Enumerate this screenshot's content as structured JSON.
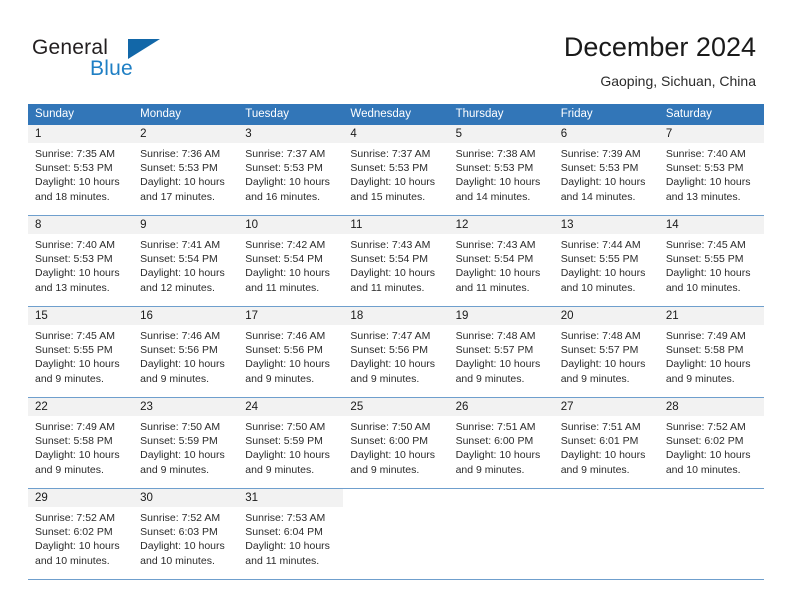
{
  "brand": {
    "word1": "General",
    "word2": "Blue",
    "triangle_color": "#1267a8",
    "blue_text_color": "#1f7fc4"
  },
  "header": {
    "title": "December 2024",
    "subtitle": "Gaoping, Sichuan, China"
  },
  "theme": {
    "header_blue": "#3276b8",
    "grid_line": "#6f9fcd",
    "daynum_band": "#f2f2f2"
  },
  "weekdays": [
    "Sunday",
    "Monday",
    "Tuesday",
    "Wednesday",
    "Thursday",
    "Friday",
    "Saturday"
  ],
  "weeks": [
    [
      {
        "day": "1",
        "sunrise": "Sunrise: 7:35 AM",
        "sunset": "Sunset: 5:53 PM",
        "daylight1": "Daylight: 10 hours",
        "daylight2": "and 18 minutes."
      },
      {
        "day": "2",
        "sunrise": "Sunrise: 7:36 AM",
        "sunset": "Sunset: 5:53 PM",
        "daylight1": "Daylight: 10 hours",
        "daylight2": "and 17 minutes."
      },
      {
        "day": "3",
        "sunrise": "Sunrise: 7:37 AM",
        "sunset": "Sunset: 5:53 PM",
        "daylight1": "Daylight: 10 hours",
        "daylight2": "and 16 minutes."
      },
      {
        "day": "4",
        "sunrise": "Sunrise: 7:37 AM",
        "sunset": "Sunset: 5:53 PM",
        "daylight1": "Daylight: 10 hours",
        "daylight2": "and 15 minutes."
      },
      {
        "day": "5",
        "sunrise": "Sunrise: 7:38 AM",
        "sunset": "Sunset: 5:53 PM",
        "daylight1": "Daylight: 10 hours",
        "daylight2": "and 14 minutes."
      },
      {
        "day": "6",
        "sunrise": "Sunrise: 7:39 AM",
        "sunset": "Sunset: 5:53 PM",
        "daylight1": "Daylight: 10 hours",
        "daylight2": "and 14 minutes."
      },
      {
        "day": "7",
        "sunrise": "Sunrise: 7:40 AM",
        "sunset": "Sunset: 5:53 PM",
        "daylight1": "Daylight: 10 hours",
        "daylight2": "and 13 minutes."
      }
    ],
    [
      {
        "day": "8",
        "sunrise": "Sunrise: 7:40 AM",
        "sunset": "Sunset: 5:53 PM",
        "daylight1": "Daylight: 10 hours",
        "daylight2": "and 13 minutes."
      },
      {
        "day": "9",
        "sunrise": "Sunrise: 7:41 AM",
        "sunset": "Sunset: 5:54 PM",
        "daylight1": "Daylight: 10 hours",
        "daylight2": "and 12 minutes."
      },
      {
        "day": "10",
        "sunrise": "Sunrise: 7:42 AM",
        "sunset": "Sunset: 5:54 PM",
        "daylight1": "Daylight: 10 hours",
        "daylight2": "and 11 minutes."
      },
      {
        "day": "11",
        "sunrise": "Sunrise: 7:43 AM",
        "sunset": "Sunset: 5:54 PM",
        "daylight1": "Daylight: 10 hours",
        "daylight2": "and 11 minutes."
      },
      {
        "day": "12",
        "sunrise": "Sunrise: 7:43 AM",
        "sunset": "Sunset: 5:54 PM",
        "daylight1": "Daylight: 10 hours",
        "daylight2": "and 11 minutes."
      },
      {
        "day": "13",
        "sunrise": "Sunrise: 7:44 AM",
        "sunset": "Sunset: 5:55 PM",
        "daylight1": "Daylight: 10 hours",
        "daylight2": "and 10 minutes."
      },
      {
        "day": "14",
        "sunrise": "Sunrise: 7:45 AM",
        "sunset": "Sunset: 5:55 PM",
        "daylight1": "Daylight: 10 hours",
        "daylight2": "and 10 minutes."
      }
    ],
    [
      {
        "day": "15",
        "sunrise": "Sunrise: 7:45 AM",
        "sunset": "Sunset: 5:55 PM",
        "daylight1": "Daylight: 10 hours",
        "daylight2": "and 9 minutes."
      },
      {
        "day": "16",
        "sunrise": "Sunrise: 7:46 AM",
        "sunset": "Sunset: 5:56 PM",
        "daylight1": "Daylight: 10 hours",
        "daylight2": "and 9 minutes."
      },
      {
        "day": "17",
        "sunrise": "Sunrise: 7:46 AM",
        "sunset": "Sunset: 5:56 PM",
        "daylight1": "Daylight: 10 hours",
        "daylight2": "and 9 minutes."
      },
      {
        "day": "18",
        "sunrise": "Sunrise: 7:47 AM",
        "sunset": "Sunset: 5:56 PM",
        "daylight1": "Daylight: 10 hours",
        "daylight2": "and 9 minutes."
      },
      {
        "day": "19",
        "sunrise": "Sunrise: 7:48 AM",
        "sunset": "Sunset: 5:57 PM",
        "daylight1": "Daylight: 10 hours",
        "daylight2": "and 9 minutes."
      },
      {
        "day": "20",
        "sunrise": "Sunrise: 7:48 AM",
        "sunset": "Sunset: 5:57 PM",
        "daylight1": "Daylight: 10 hours",
        "daylight2": "and 9 minutes."
      },
      {
        "day": "21",
        "sunrise": "Sunrise: 7:49 AM",
        "sunset": "Sunset: 5:58 PM",
        "daylight1": "Daylight: 10 hours",
        "daylight2": "and 9 minutes."
      }
    ],
    [
      {
        "day": "22",
        "sunrise": "Sunrise: 7:49 AM",
        "sunset": "Sunset: 5:58 PM",
        "daylight1": "Daylight: 10 hours",
        "daylight2": "and 9 minutes."
      },
      {
        "day": "23",
        "sunrise": "Sunrise: 7:50 AM",
        "sunset": "Sunset: 5:59 PM",
        "daylight1": "Daylight: 10 hours",
        "daylight2": "and 9 minutes."
      },
      {
        "day": "24",
        "sunrise": "Sunrise: 7:50 AM",
        "sunset": "Sunset: 5:59 PM",
        "daylight1": "Daylight: 10 hours",
        "daylight2": "and 9 minutes."
      },
      {
        "day": "25",
        "sunrise": "Sunrise: 7:50 AM",
        "sunset": "Sunset: 6:00 PM",
        "daylight1": "Daylight: 10 hours",
        "daylight2": "and 9 minutes."
      },
      {
        "day": "26",
        "sunrise": "Sunrise: 7:51 AM",
        "sunset": "Sunset: 6:00 PM",
        "daylight1": "Daylight: 10 hours",
        "daylight2": "and 9 minutes."
      },
      {
        "day": "27",
        "sunrise": "Sunrise: 7:51 AM",
        "sunset": "Sunset: 6:01 PM",
        "daylight1": "Daylight: 10 hours",
        "daylight2": "and 9 minutes."
      },
      {
        "day": "28",
        "sunrise": "Sunrise: 7:52 AM",
        "sunset": "Sunset: 6:02 PM",
        "daylight1": "Daylight: 10 hours",
        "daylight2": "and 10 minutes."
      }
    ],
    [
      {
        "day": "29",
        "sunrise": "Sunrise: 7:52 AM",
        "sunset": "Sunset: 6:02 PM",
        "daylight1": "Daylight: 10 hours",
        "daylight2": "and 10 minutes."
      },
      {
        "day": "30",
        "sunrise": "Sunrise: 7:52 AM",
        "sunset": "Sunset: 6:03 PM",
        "daylight1": "Daylight: 10 hours",
        "daylight2": "and 10 minutes."
      },
      {
        "day": "31",
        "sunrise": "Sunrise: 7:53 AM",
        "sunset": "Sunset: 6:04 PM",
        "daylight1": "Daylight: 10 hours",
        "daylight2": "and 11 minutes."
      },
      {
        "day": "",
        "sunrise": "",
        "sunset": "",
        "daylight1": "",
        "daylight2": ""
      },
      {
        "day": "",
        "sunrise": "",
        "sunset": "",
        "daylight1": "",
        "daylight2": ""
      },
      {
        "day": "",
        "sunrise": "",
        "sunset": "",
        "daylight1": "",
        "daylight2": ""
      },
      {
        "day": "",
        "sunrise": "",
        "sunset": "",
        "daylight1": "",
        "daylight2": ""
      }
    ]
  ]
}
